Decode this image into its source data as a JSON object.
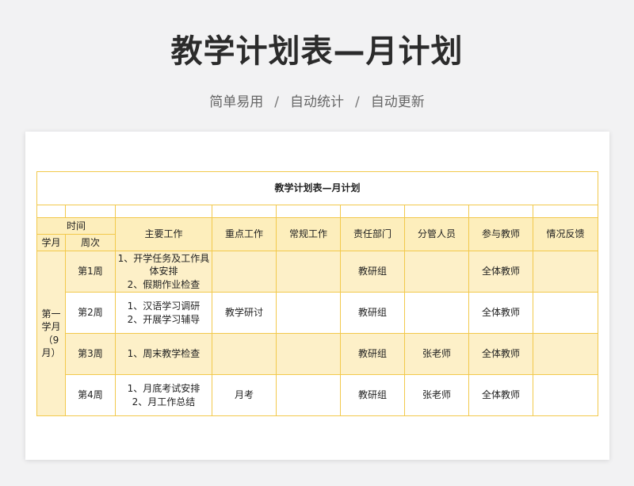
{
  "header": {
    "title": "教学计划表—月计划",
    "subtitle_items": [
      "简单易用",
      "自动统计",
      "自动更新"
    ],
    "subtitle_separator": "/"
  },
  "sheet": {
    "title": "教学计划表—月计划",
    "columns": {
      "time": "时间",
      "month": "学月",
      "week": "周次",
      "main_work": "主要工作",
      "key_work": "重点工作",
      "routine_work": "常规工作",
      "dept": "责任部门",
      "manager": "分管人员",
      "teachers": "参与教师",
      "feedback": "情况反馈"
    },
    "month_label": "第一学月（9月）",
    "rows": [
      {
        "week": "第1周",
        "main_work": "1、开学任务及工作具体安排\n2、假期作业检查",
        "key_work": "",
        "routine_work": "",
        "dept": "教研组",
        "manager": "",
        "teachers": "全体教师",
        "feedback": ""
      },
      {
        "week": "第2周",
        "main_work": "1、汉语学习调研\n2、开展学习辅导",
        "key_work": "教学研讨",
        "routine_work": "",
        "dept": "教研组",
        "manager": "",
        "teachers": "全体教师",
        "feedback": ""
      },
      {
        "week": "第3周",
        "main_work": "1、周末教学检查",
        "key_work": "",
        "routine_work": "",
        "dept": "教研组",
        "manager": "张老师",
        "teachers": "全体教师",
        "feedback": ""
      },
      {
        "week": "第4周",
        "main_work": "1、月底考试安排\n2、月工作总结",
        "key_work": "月考",
        "routine_work": "",
        "dept": "教研组",
        "manager": "张老师",
        "teachers": "全体教师",
        "feedback": ""
      }
    ]
  }
}
